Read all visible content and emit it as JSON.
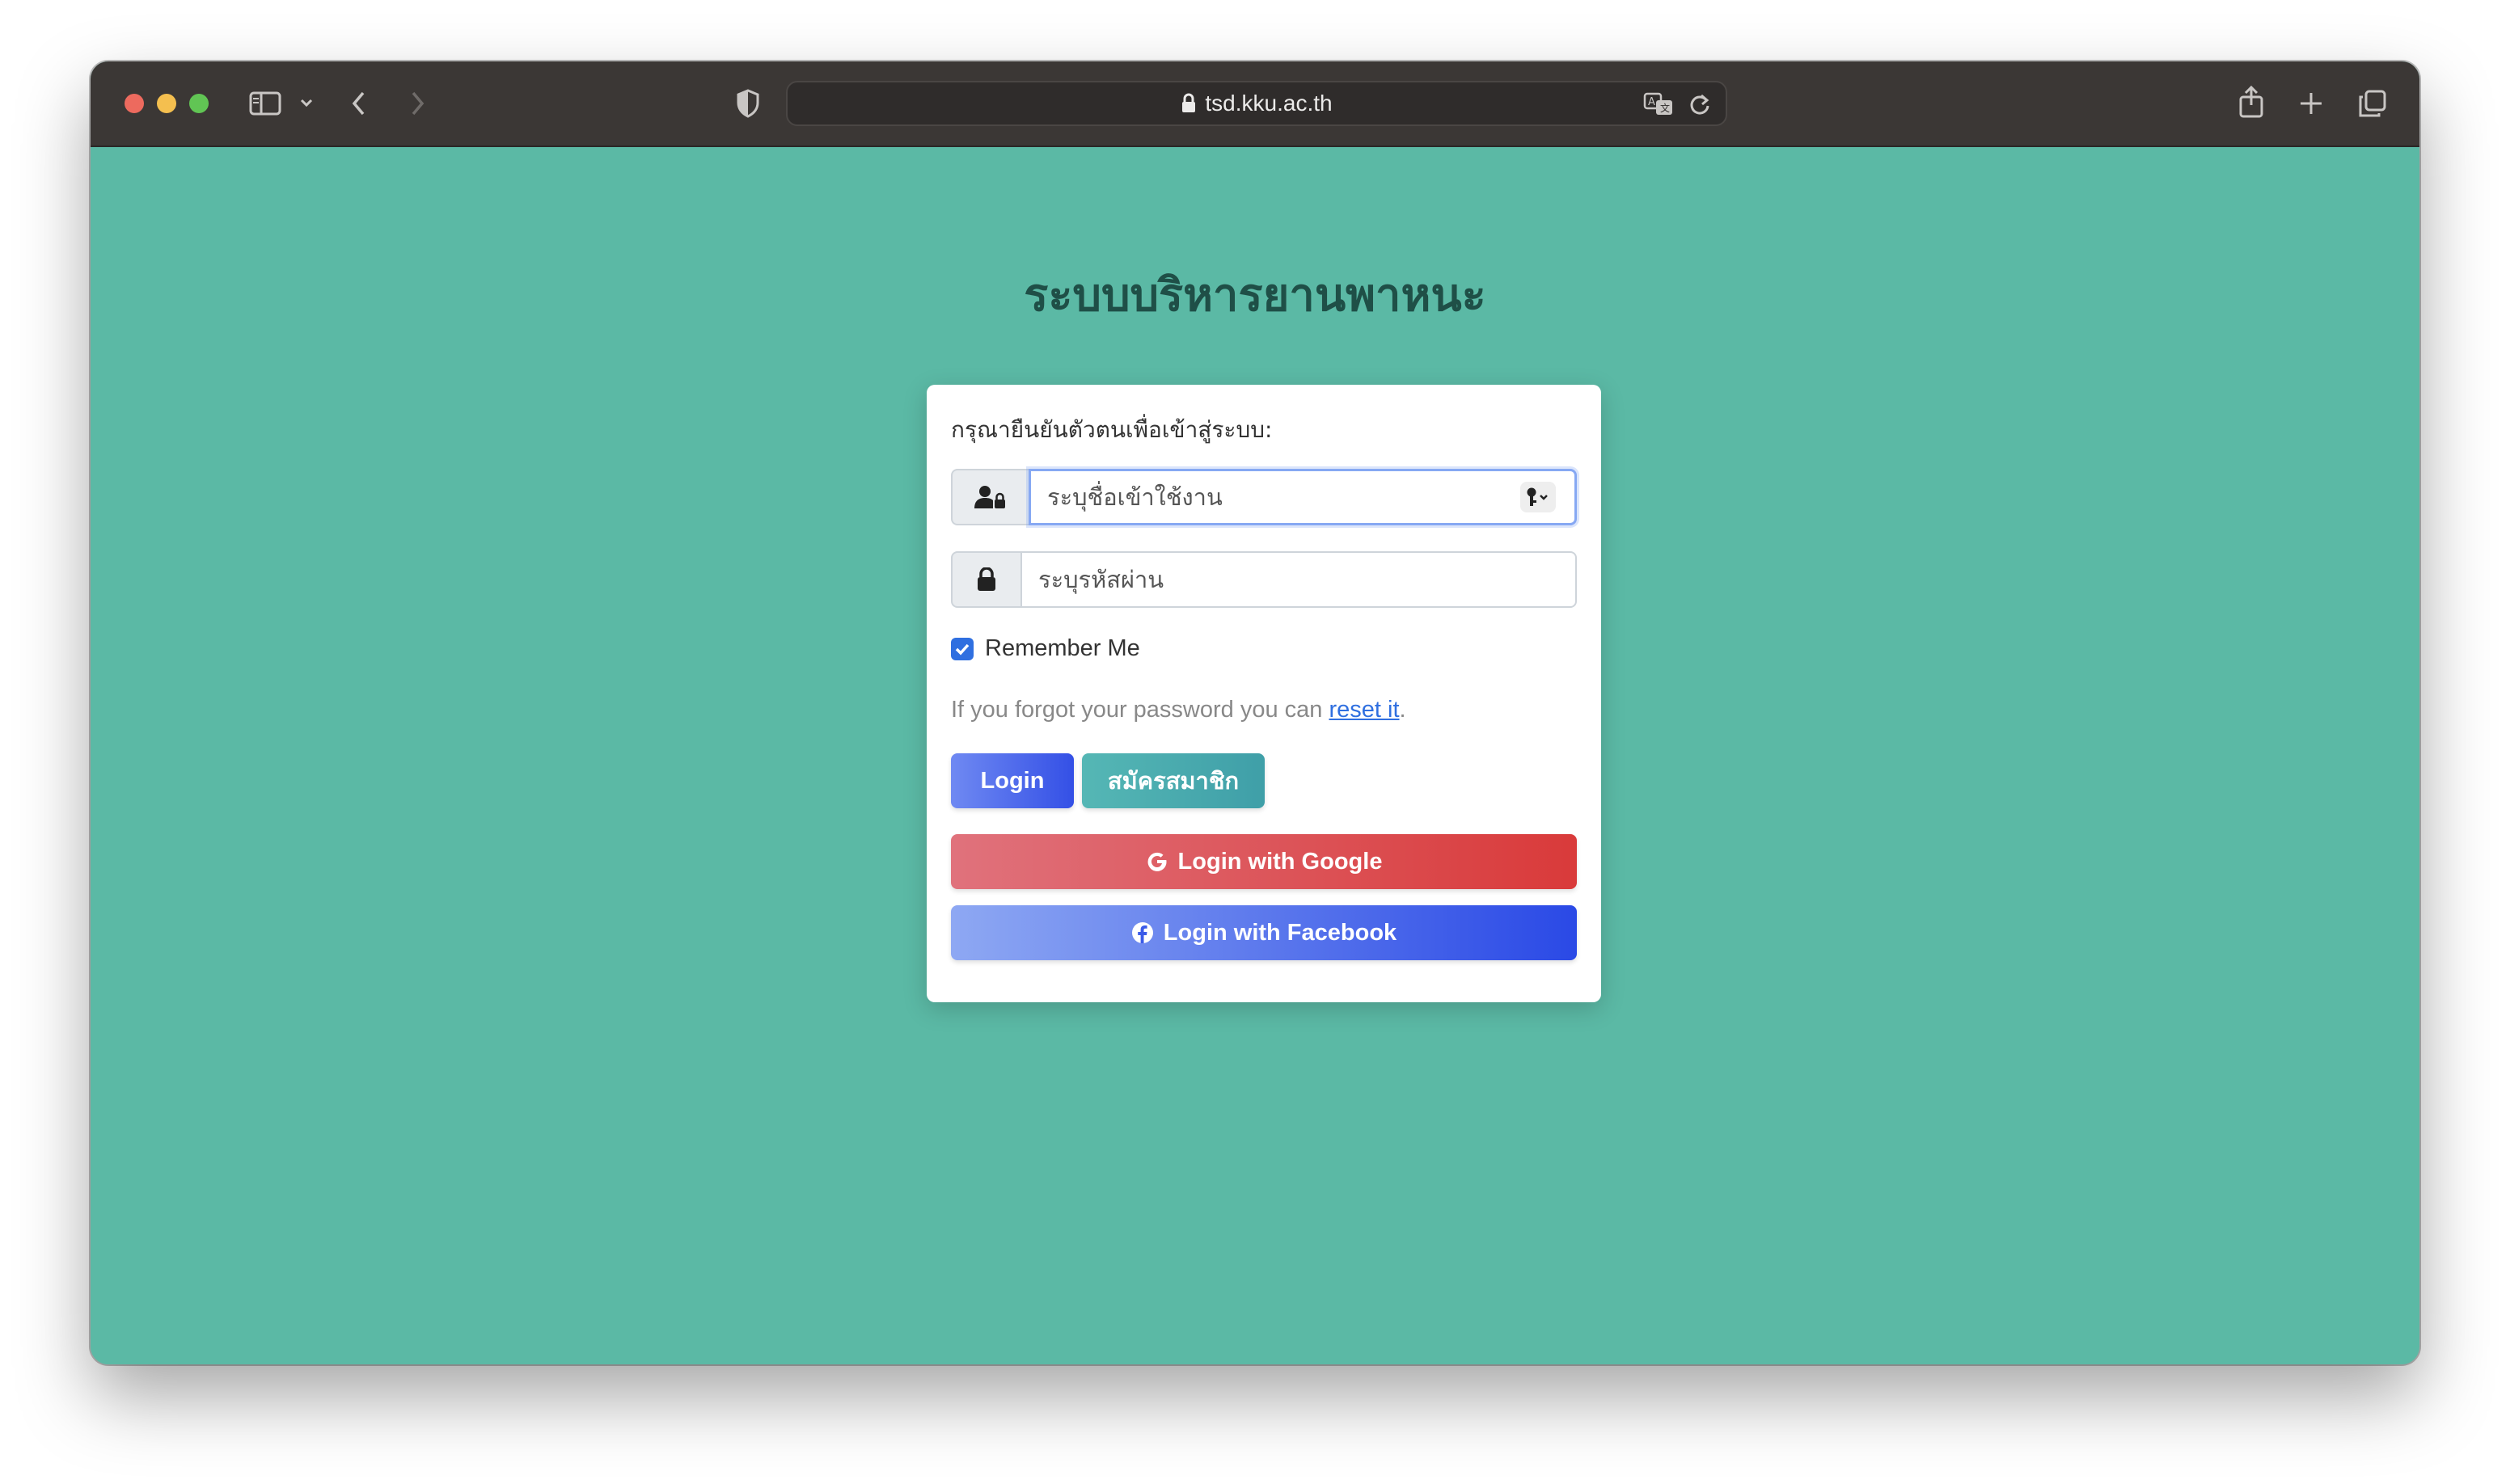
{
  "browser": {
    "url": "tsd.kku.ac.th"
  },
  "page": {
    "title": "ระบบบริหารยานพาหนะ"
  },
  "login_card": {
    "prompt": "กรุณายืนยันตัวตนเพื่อเข้าสู่ระบบ:",
    "username_placeholder": "ระบุชื่อเข้าใช้งาน",
    "password_placeholder": "ระบุรหัสผ่าน",
    "remember_label": "Remember Me",
    "remember_checked": true,
    "forgot_text": "If you forgot your password you can ",
    "forgot_link": "reset it",
    "forgot_suffix": ".",
    "login_label": "Login",
    "register_label": "สมัครสมาชิก",
    "google_label": "Login with Google",
    "facebook_label": "Login with Facebook"
  },
  "colors": {
    "background": "#5bb9a5",
    "primary": "#3450e6",
    "google": "#d93a3a",
    "register": "#3f9fa8"
  },
  "icons": [
    "user-lock-icon",
    "lock-icon",
    "key-icon",
    "check-icon",
    "google-icon",
    "facebook-icon",
    "sidebar-icon",
    "back-icon",
    "forward-icon",
    "shield-icon",
    "translate-icon",
    "reload-icon",
    "share-icon",
    "new-tab-icon",
    "tabs-icon"
  ]
}
